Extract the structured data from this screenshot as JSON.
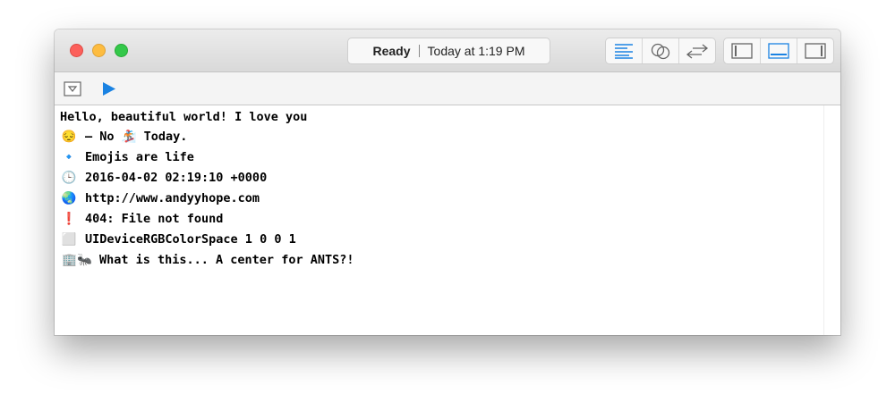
{
  "window": {
    "status": {
      "state": "Ready",
      "time": "Today at 1:19 PM"
    }
  },
  "console": {
    "lines": [
      {
        "icon": "",
        "text": "Hello, beautiful world! I love you"
      },
      {
        "icon": "😔",
        "text": "— No 🏂 Today."
      },
      {
        "icon": "🔹",
        "text": "Emojis are life"
      },
      {
        "icon": "🕒",
        "text": "2016-04-02 02:19:10 +0000"
      },
      {
        "icon": "🌏",
        "text": "http://www.andyyhope.com"
      },
      {
        "icon": "❗",
        "text": "404: File not found"
      },
      {
        "icon": "⬜",
        "text": "UIDeviceRGBColorSpace 1 0 0 1"
      },
      {
        "icon": "🏢🐜",
        "text": "What is this... A center for ANTS?!"
      }
    ]
  },
  "colors": {
    "accent": "#1a82e2",
    "close": "#fc605b",
    "minimize": "#fdbc40",
    "zoom": "#34c84a"
  }
}
